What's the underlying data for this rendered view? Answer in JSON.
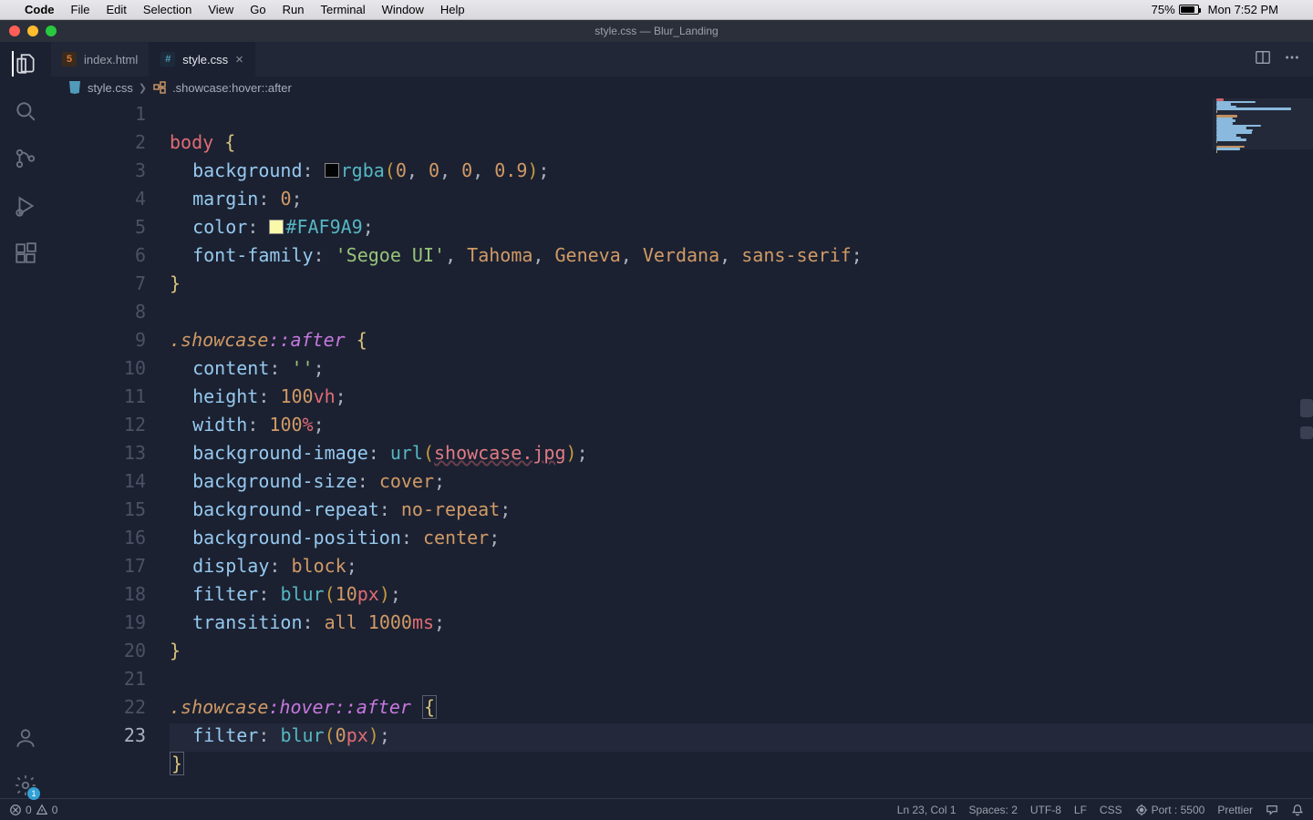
{
  "macos_menu": {
    "app": "Code",
    "items": [
      "File",
      "Edit",
      "Selection",
      "View",
      "Go",
      "Run",
      "Terminal",
      "Window",
      "Help"
    ],
    "battery_pct": "75%",
    "clock": "Mon 7:52 PM"
  },
  "window_title": "style.css — Blur_Landing",
  "tabs": [
    {
      "label": "index.html",
      "icon": "html",
      "active": false,
      "dirty": false
    },
    {
      "label": "style.css",
      "icon": "css",
      "active": true,
      "dirty": false
    }
  ],
  "breadcrumbs": {
    "file": "style.css",
    "symbol": ".showcase:hover::after"
  },
  "active_line": 23,
  "code_lines": [
    {
      "n": 1,
      "html": "<span class='tk-sel'>body</span> <span class='tk-brace'>{</span>"
    },
    {
      "n": 2,
      "html": "  <span class='tk-prop'>background</span><span class='tk-punc'>:</span> <span class='color-swatch' style='background:rgba(0,0,0,0.9)'></span><span class='tk-func'>rgba</span><span class='tk-paren'>(</span><span class='tk-num'>0</span><span class='tk-punc'>,</span> <span class='tk-num'>0</span><span class='tk-punc'>,</span> <span class='tk-num'>0</span><span class='tk-punc'>,</span> <span class='tk-num'>0.9</span><span class='tk-paren'>)</span><span class='tk-punc'>;</span>"
    },
    {
      "n": 3,
      "html": "  <span class='tk-prop'>margin</span><span class='tk-punc'>:</span> <span class='tk-num'>0</span><span class='tk-punc'>;</span>"
    },
    {
      "n": 4,
      "html": "  <span class='tk-prop'>color</span><span class='tk-punc'>:</span> <span class='color-swatch' style='background:#FAF9A9'></span><span class='tk-hex'>#FAF9A9</span><span class='tk-punc'>;</span>"
    },
    {
      "n": 5,
      "html": "  <span class='tk-prop'>font-family</span><span class='tk-punc'>:</span> <span class='tk-str'>'Segoe UI'</span><span class='tk-punc'>,</span> <span class='tk-font'>Tahoma</span><span class='tk-punc'>,</span> <span class='tk-font'>Geneva</span><span class='tk-punc'>,</span> <span class='tk-font'>Verdana</span><span class='tk-punc'>,</span> <span class='tk-kw'>sans-serif</span><span class='tk-punc'>;</span>"
    },
    {
      "n": 6,
      "html": "<span class='tk-brace'>}</span>"
    },
    {
      "n": 7,
      "html": ""
    },
    {
      "n": 8,
      "html": "<span class='tk-class'>.showcase</span><span class='tk-pseudo'>::after</span> <span class='tk-brace'>{</span>"
    },
    {
      "n": 9,
      "html": "  <span class='tk-prop'>content</span><span class='tk-punc'>:</span> <span class='tk-str'>''</span><span class='tk-punc'>;</span>"
    },
    {
      "n": 10,
      "html": "  <span class='tk-prop'>height</span><span class='tk-punc'>:</span> <span class='tk-num'>100</span><span class='tk-unit'>vh</span><span class='tk-punc'>;</span>"
    },
    {
      "n": 11,
      "html": "  <span class='tk-prop'>width</span><span class='tk-punc'>:</span> <span class='tk-num'>100</span><span class='tk-unit'>%</span><span class='tk-punc'>;</span>"
    },
    {
      "n": 12,
      "html": "  <span class='tk-prop'>background-image</span><span class='tk-punc'>:</span> <span class='tk-func'>url</span><span class='tk-paren'>(</span><span class='tk-url'>showcase.jpg</span><span class='tk-paren'>)</span><span class='tk-punc'>;</span>"
    },
    {
      "n": 13,
      "html": "  <span class='tk-prop'>background-size</span><span class='tk-punc'>:</span> <span class='tk-kw'>cover</span><span class='tk-punc'>;</span>"
    },
    {
      "n": 14,
      "html": "  <span class='tk-prop'>background-repeat</span><span class='tk-punc'>:</span> <span class='tk-kw'>no-repeat</span><span class='tk-punc'>;</span>"
    },
    {
      "n": 15,
      "html": "  <span class='tk-prop'>background-position</span><span class='tk-punc'>:</span> <span class='tk-kw'>center</span><span class='tk-punc'>;</span>"
    },
    {
      "n": 16,
      "html": "  <span class='tk-prop'>display</span><span class='tk-punc'>:</span> <span class='tk-kw'>block</span><span class='tk-punc'>;</span>"
    },
    {
      "n": 17,
      "html": "  <span class='tk-prop'>filter</span><span class='tk-punc'>:</span> <span class='tk-func'>blur</span><span class='tk-paren'>(</span><span class='tk-num'>10</span><span class='tk-unit'>px</span><span class='tk-paren'>)</span><span class='tk-punc'>;</span>"
    },
    {
      "n": 18,
      "html": "  <span class='tk-prop'>transition</span><span class='tk-punc'>:</span> <span class='tk-kw'>all</span> <span class='tk-num'>1000</span><span class='tk-unit'>ms</span><span class='tk-punc'>;</span>"
    },
    {
      "n": 19,
      "html": "<span class='tk-brace'>}</span>"
    },
    {
      "n": 20,
      "html": ""
    },
    {
      "n": 21,
      "html": "<span class='tk-class'>.showcase</span><span class='tk-pseudo'>:hover</span><span class='tk-pseudo'>::after</span> <span class='tk-brace brace-match'>{</span>"
    },
    {
      "n": 22,
      "html": "  <span class='tk-prop'>filter</span><span class='tk-punc'>:</span> <span class='tk-func'>blur</span><span class='tk-paren'>(</span><span class='tk-num'>0</span><span class='tk-unit'>px</span><span class='tk-paren'>)</span><span class='tk-punc'>;</span>"
    },
    {
      "n": 23,
      "html": "<span class='tk-brace brace-match'>}</span>"
    }
  ],
  "status_bar": {
    "errors": "0",
    "warnings": "0",
    "cursor": "Ln 23, Col 1",
    "spaces": "Spaces: 2",
    "encoding": "UTF-8",
    "eol": "LF",
    "lang": "CSS",
    "port": "Port : 5500",
    "formatter": "Prettier"
  },
  "settings_badge": "1"
}
